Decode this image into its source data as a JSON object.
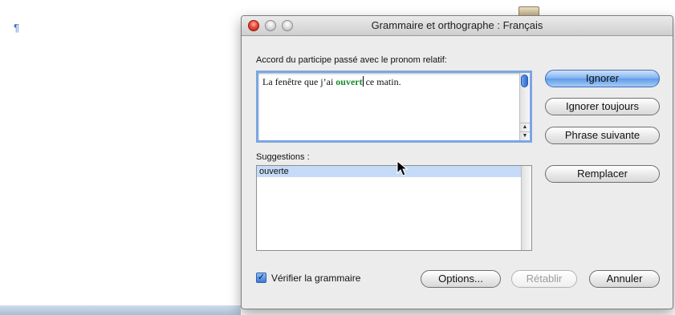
{
  "document": {
    "pilcrow": "¶"
  },
  "dialog": {
    "title": "Grammaire et orthographe : Français",
    "rule_label": "Accord du participe passé avec le pronom relatif:",
    "sentence": {
      "before": "La fenêtre que j’ai ",
      "error": "ouvert",
      "after": " ce matin."
    },
    "suggestions_label": "Suggestions :",
    "suggestions": [
      "ouverte"
    ],
    "buttons": {
      "ignore": "Ignorer",
      "ignore_always": "Ignorer toujours",
      "next_sentence": "Phrase suivante",
      "replace": "Remplacer",
      "options": "Options...",
      "restore": "Rétablir",
      "cancel": "Annuler"
    },
    "check_grammar": {
      "label": "Vérifier la grammaire",
      "checked": true,
      "mark": "✓"
    }
  },
  "colors": {
    "error_text": "#178a2f",
    "accent": "#5d9ae8",
    "selection": "#c5dbf7"
  },
  "icons": {
    "scroll_up": "▲",
    "scroll_down": "▼"
  }
}
